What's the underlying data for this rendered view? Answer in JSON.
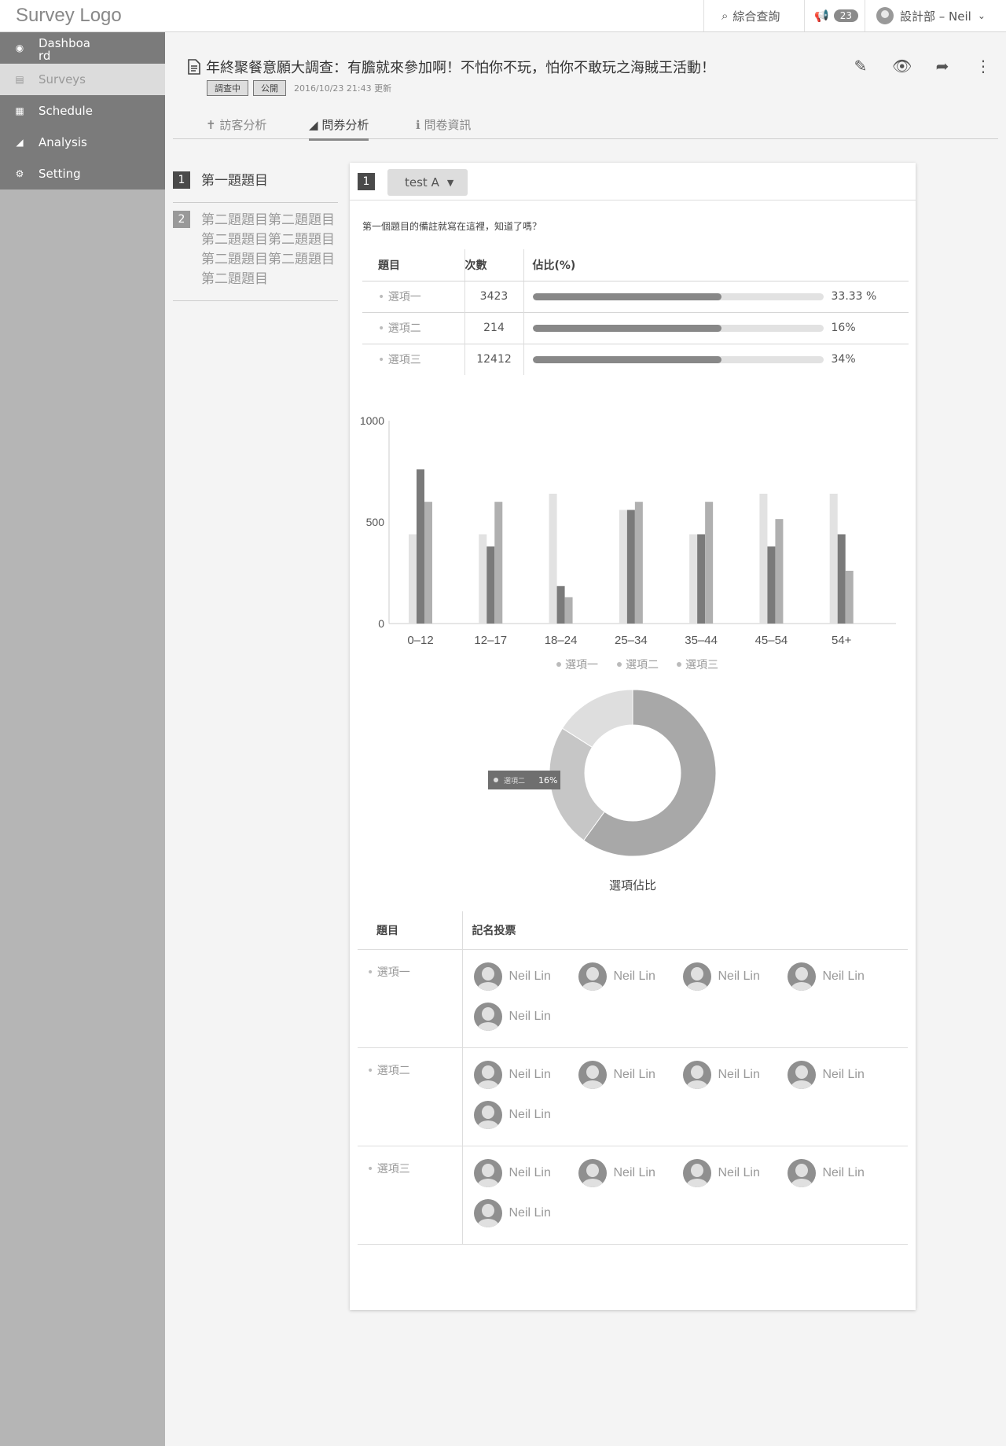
{
  "topbar": {
    "logo": "Survey Logo",
    "search_label": "綜合查詢",
    "notification_count": "23",
    "user_label": "設計部 – Neil"
  },
  "sidebar": {
    "items": [
      {
        "label": "Dashboard",
        "icon": "dashboard-icon"
      },
      {
        "label": "Surveys",
        "icon": "document-icon"
      },
      {
        "label": "Schedule",
        "icon": "calendar-icon"
      },
      {
        "label": "Analysis",
        "icon": "area-chart-icon"
      },
      {
        "label": "Setting",
        "icon": "gear-icon"
      }
    ]
  },
  "survey": {
    "title": "年終聚餐意願大調查：有膽就來參加啊！不怕你不玩，怕你不敢玩之海賊王活動！",
    "status_tag": "調查中",
    "visibility_tag": "公開",
    "updated": "2016/10/23 21:43 更新"
  },
  "tabs": [
    {
      "label": "訪客分析",
      "icon": "visitor-icon"
    },
    {
      "label": "問券分析",
      "icon": "area-chart-icon"
    },
    {
      "label": "問卷資訊",
      "icon": "info-icon"
    }
  ],
  "questions": [
    {
      "num": "1",
      "text": "第一題題目"
    },
    {
      "num": "2",
      "text": "第二題題目第二題題目第二題題目第二題題目第二題題目第二題題目第二題題目"
    }
  ],
  "card": {
    "num": "1",
    "select_value": "test A",
    "note": "第一個題目的備註就寫在這裡，知道了嗎？",
    "table_headers": [
      "題目",
      "次數",
      "佔比(%)"
    ],
    "rows": [
      {
        "option": "選項一",
        "count": "3423",
        "pct": "33.33 %",
        "fill": 0.65
      },
      {
        "option": "選項二",
        "count": "214",
        "pct": "16%",
        "fill": 0.65
      },
      {
        "option": "選項三",
        "count": "12412",
        "pct": "34%",
        "fill": 0.65
      }
    ],
    "vote_headers": [
      "題目",
      "記名投票"
    ],
    "votes": [
      {
        "option": "選項一",
        "voters": [
          "Neil Lin",
          "Neil Lin",
          "Neil Lin",
          "Neil Lin",
          "Neil Lin"
        ]
      },
      {
        "option": "選項二",
        "voters": [
          "Neil Lin",
          "Neil Lin",
          "Neil Lin",
          "Neil Lin",
          "Neil Lin"
        ]
      },
      {
        "option": "選項三",
        "voters": [
          "Neil Lin",
          "Neil Lin",
          "Neil Lin",
          "Neil Lin",
          "Neil Lin"
        ]
      }
    ]
  },
  "chart_data": [
    {
      "type": "bar",
      "categories": [
        "0–12",
        "12–17",
        "18–24",
        "25–34",
        "35–44",
        "45–54",
        "54+"
      ],
      "series": [
        {
          "name": "選項一",
          "values": [
            440,
            440,
            640,
            560,
            440,
            640,
            640
          ],
          "color": "#e2e2e2"
        },
        {
          "name": "選項二",
          "values": [
            760,
            380,
            185,
            560,
            440,
            380,
            440
          ],
          "color": "#7a7a7a"
        },
        {
          "name": "選項三",
          "values": [
            600,
            600,
            130,
            600,
            600,
            515,
            260
          ],
          "color": "#b0b0b0"
        }
      ],
      "yticks": [
        0,
        500,
        1000
      ],
      "ylim": [
        0,
        1000
      ],
      "legend": "bottom",
      "grid": false
    },
    {
      "type": "pie",
      "title": "選項佔比",
      "slices": [
        {
          "name": "選項一",
          "value": 60,
          "color": "#a8a8a8"
        },
        {
          "name": "選項二",
          "value": 24,
          "color": "#c6c6c6"
        },
        {
          "name": "選項三",
          "value": 16,
          "color": "#dedede"
        }
      ],
      "tooltip": {
        "name": "選項二",
        "value": "16%"
      }
    }
  ]
}
